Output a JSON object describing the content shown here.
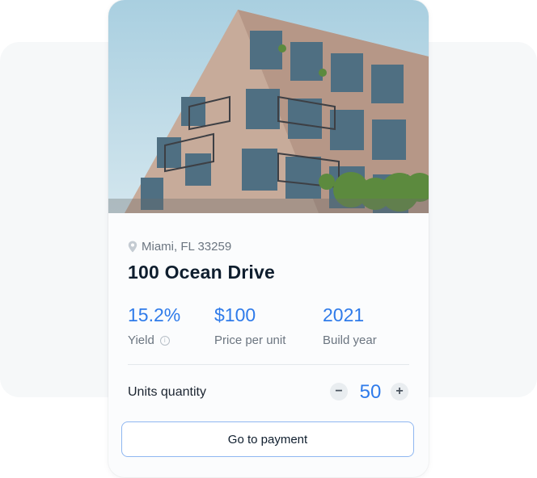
{
  "property": {
    "location": "Miami, FL 33259",
    "name": "100 Ocean Drive",
    "stats": [
      {
        "value": "15.2%",
        "label": "Yield",
        "has_info": true
      },
      {
        "value": "$100",
        "label": "Price per unit"
      },
      {
        "value": "2021",
        "label": "Build year"
      }
    ]
  },
  "order": {
    "quantity_label": "Units quantity",
    "quantity": "50",
    "minus_symbol": "−",
    "plus_symbol": "+",
    "pay_button_label": "Go to payment"
  },
  "icons": {
    "location": "map-pin-icon",
    "info": "info-icon"
  },
  "colors": {
    "accent": "#2f7bea",
    "title": "#0f1e2e",
    "muted": "#6b7580",
    "button_border": "#8fb7f1"
  }
}
